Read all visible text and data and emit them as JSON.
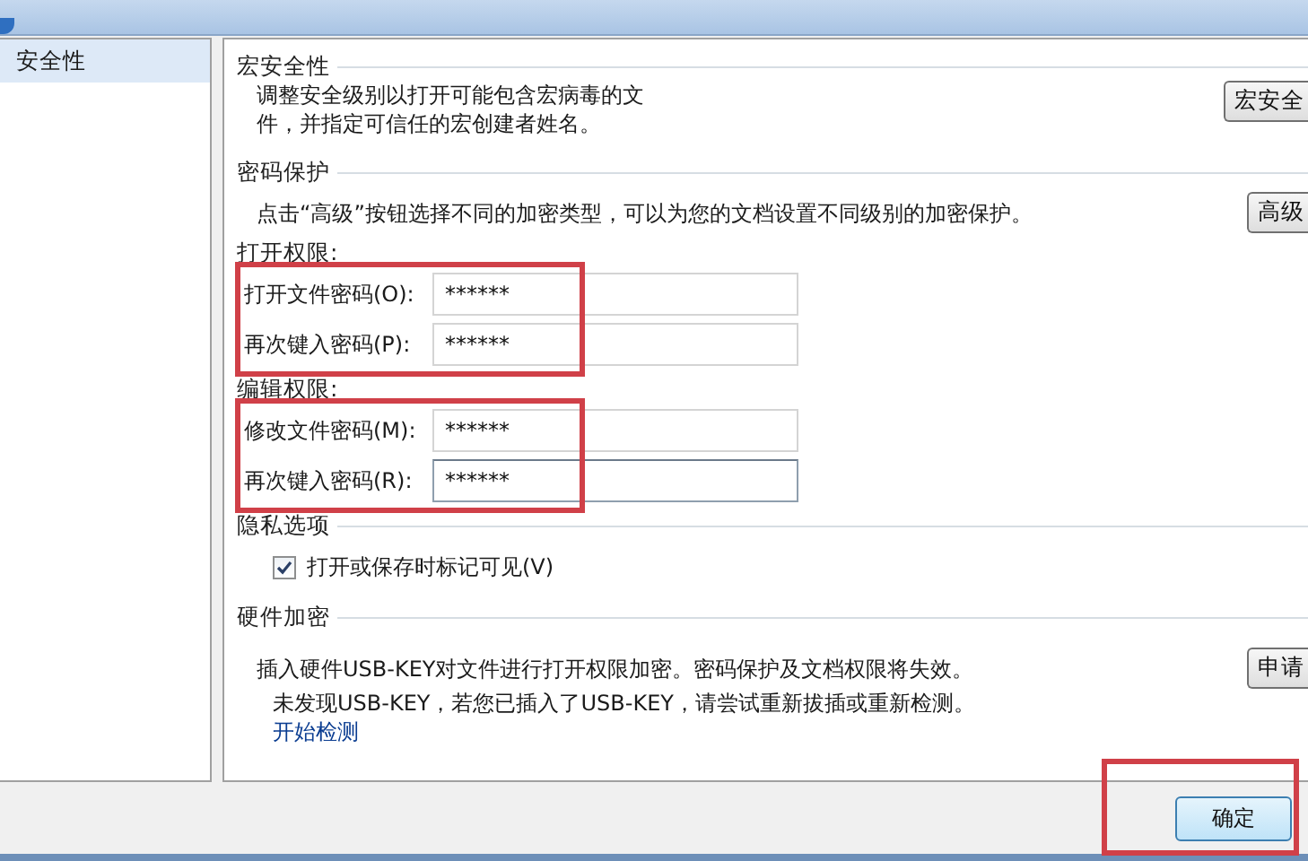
{
  "sidebar": {
    "items": [
      {
        "label": "安全性",
        "selected": true
      }
    ]
  },
  "macro_security": {
    "title": "宏安全性",
    "description_lines": [
      "调整安全级别以打开可能包含宏病毒的文",
      "件，并指定可信任的宏创建者姓名。"
    ],
    "button": "宏安全"
  },
  "password_protection": {
    "title": "密码保护",
    "description": "点击“高级”按钮选择不同的加密类型，可以为您的文档设置不同级别的加密保护。",
    "button": "高级"
  },
  "open_permissions": {
    "title": "打开权限:",
    "highlighted": true,
    "fields": [
      {
        "label": "打开文件密码(O):",
        "value": "******",
        "focused": false
      },
      {
        "label": "再次键入密码(P):",
        "value": "******",
        "focused": false
      }
    ]
  },
  "edit_permissions": {
    "title": "编辑权限:",
    "highlighted": true,
    "fields": [
      {
        "label": "修改文件密码(M):",
        "value": "******",
        "focused": false
      },
      {
        "label": "再次键入密码(R):",
        "value": "******",
        "focused": true
      }
    ]
  },
  "privacy": {
    "title": "隐私选项",
    "checkbox": {
      "label": "打开或保存时标记可见(V)",
      "checked": true
    }
  },
  "hardware_encryption": {
    "title": "硬件加密",
    "description": "插入硬件USB-KEY对文件进行打开权限加密。密码保护及文档权限将失效。",
    "button": "申请",
    "status": "未发现USB-KEY，若您已插入了USB-KEY，请尝试重新拔插或重新检测。",
    "link": "开始检测"
  },
  "ok_button": {
    "label": "确定",
    "highlighted": true
  }
}
